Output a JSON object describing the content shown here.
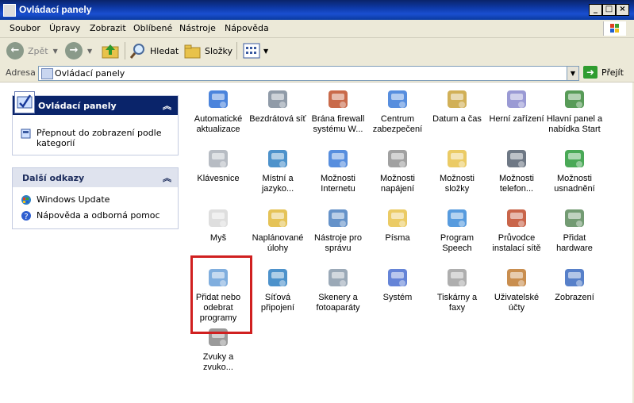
{
  "window": {
    "title": "Ovládací panely",
    "min": "_",
    "max": "□",
    "close": "×"
  },
  "menu": [
    "Soubor",
    "Úpravy",
    "Zobrazit",
    "Oblíbené",
    "Nástroje",
    "Nápověda"
  ],
  "toolbar": {
    "back": "Zpět",
    "search": "Hledat",
    "folders": "Složky"
  },
  "address": {
    "label": "Adresa",
    "value": "Ovládací panely",
    "go": "Přejít"
  },
  "sidebar": {
    "control_panel": {
      "title": "Ovládací panely",
      "switch_link": "Přepnout do zobrazení podle kategorií"
    },
    "other_links": {
      "title": "Další odkazy",
      "items": [
        "Windows Update",
        "Nápověda a odborná pomoc"
      ]
    }
  },
  "items": [
    [
      "Automatické",
      "aktualizace"
    ],
    [
      "Bezdrátová síť"
    ],
    [
      "Brána firewall",
      "systému W..."
    ],
    [
      "Centrum",
      "zabezpečení"
    ],
    [
      "Datum a čas"
    ],
    [
      "Herní zařízení"
    ],
    [
      "Hlavní panel a",
      "nabídka Start"
    ],
    [
      "Klávesnice"
    ],
    [
      "Místní a",
      "jazyko..."
    ],
    [
      "Možnosti",
      "Internetu"
    ],
    [
      "Možnosti",
      "napájení"
    ],
    [
      "Možnosti",
      "složky"
    ],
    [
      "Možnosti",
      "telefon..."
    ],
    [
      "Možnosti",
      "usnadnění"
    ],
    [
      "Myš"
    ],
    [
      "Naplánované",
      "úlohy"
    ],
    [
      "Nástroje pro",
      "správu"
    ],
    [
      "Písma"
    ],
    [
      "Program",
      "Speech"
    ],
    [
      "Průvodce",
      "instalací sítě"
    ],
    [
      "Přidat",
      "hardware"
    ],
    [
      "Přidat nebo",
      "odebrat",
      "programy"
    ],
    [
      "Síťová",
      "připojení"
    ],
    [
      "Skenery a",
      "fotoaparáty"
    ],
    [
      "Systém"
    ],
    [
      "Tiskárny a",
      "faxy"
    ],
    [
      "Uživatelské",
      "účty"
    ],
    [
      "Zobrazení"
    ],
    [
      "Zvuky a",
      "zvuko..."
    ]
  ],
  "icon_names": [
    "update-icon",
    "wireless-icon",
    "firewall-icon",
    "security-center-icon",
    "clock-icon",
    "gamepad-icon",
    "taskbar-icon",
    "keyboard-icon",
    "globe-icon",
    "internet-options-icon",
    "power-icon",
    "folder-icon",
    "phone-icon",
    "accessibility-icon",
    "mouse-icon",
    "scheduled-tasks-icon",
    "admin-tools-icon",
    "fonts-icon",
    "speech-icon",
    "network-setup-icon",
    "add-hardware-icon",
    "add-remove-programs-icon",
    "network-connections-icon",
    "scanner-icon",
    "system-icon",
    "printer-icon",
    "user-accounts-icon",
    "display-icon",
    "sounds-icon"
  ],
  "icon_colors": [
    "#2b6fd6",
    "#7c8a99",
    "#c0502a",
    "#3a7ad8",
    "#c9a23a",
    "#8888cc",
    "#3b8a3b",
    "#aab0b8",
    "#2e7fc2",
    "#3a7ad8",
    "#909090",
    "#e8c24a",
    "#556070",
    "#2a9a3a",
    "#d8d8d8",
    "#e0b83a",
    "#4a7fc0",
    "#e8c24a",
    "#3a8ad8",
    "#c04a2a",
    "#5a8a5a",
    "#6aa0d8",
    "#2e7fc2",
    "#8a9aaa",
    "#4a6fd0",
    "#a0a0a0",
    "#c07a30",
    "#3a6ac0",
    "#888888"
  ]
}
